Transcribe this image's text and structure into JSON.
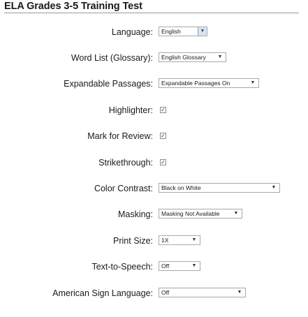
{
  "header": {
    "title": "ELA Grades 3-5 Training Test"
  },
  "settings": {
    "language": {
      "label": "Language:",
      "value": "English"
    },
    "word_list": {
      "label": "Word List (Glossary):",
      "value": "English Glossary"
    },
    "expandable_passages": {
      "label": "Expandable Passages:",
      "value": "Expandable Passages On"
    },
    "highlighter": {
      "label": "Highlighter:",
      "checked": true
    },
    "mark_for_review": {
      "label": "Mark for Review:",
      "checked": true
    },
    "strikethrough": {
      "label": "Strikethrough:",
      "checked": true
    },
    "color_contrast": {
      "label": "Color Contrast:",
      "value": "Black on White"
    },
    "masking": {
      "label": "Masking:",
      "value": "Masking Not Available"
    },
    "print_size": {
      "label": "Print Size:",
      "value": "1X"
    },
    "text_to_speech": {
      "label": "Text-to-Speech:",
      "value": "Off"
    },
    "asl": {
      "label": "American Sign Language:",
      "value": "Off"
    }
  },
  "icons": {
    "dropdown": "chevron-down-icon",
    "check": "checkmark-icon"
  }
}
